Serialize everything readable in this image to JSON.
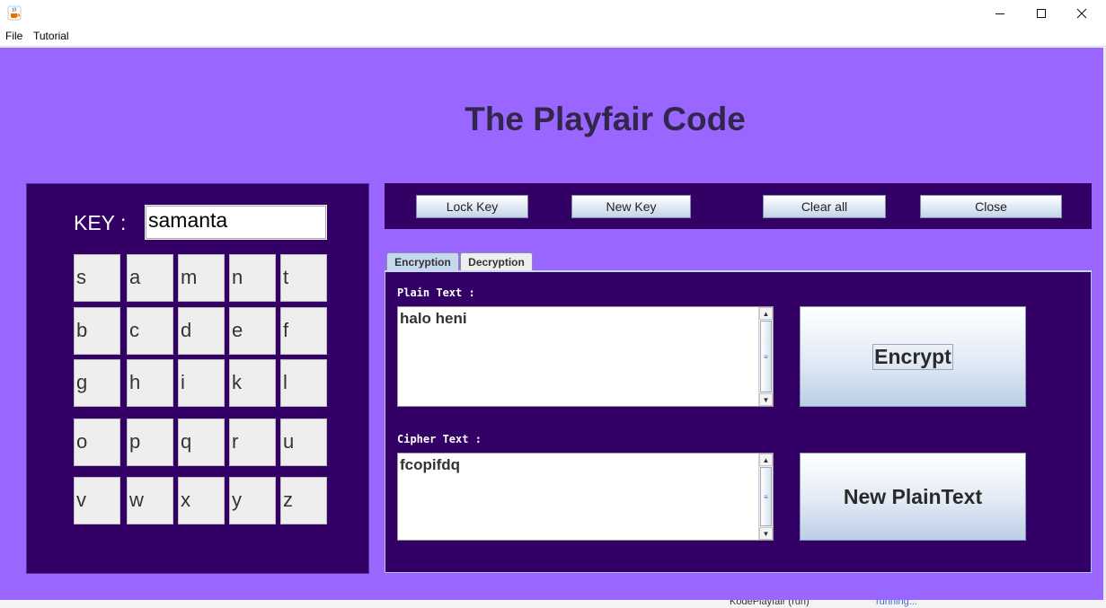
{
  "window": {
    "icons": {
      "app": "java-cup-icon",
      "minimize": "minimize-icon",
      "maximize": "maximize-icon",
      "close": "close-icon"
    }
  },
  "menubar": {
    "items": [
      {
        "label": "File"
      },
      {
        "label": "Tutorial"
      }
    ]
  },
  "page": {
    "title": "The Playfair Code"
  },
  "key_panel": {
    "key_label": "KEY :",
    "key_value": "samanta",
    "grid": [
      [
        "s",
        "a",
        "m",
        "n",
        "t"
      ],
      [
        "b",
        "c",
        "d",
        "e",
        "f"
      ],
      [
        "g",
        "h",
        "i",
        "k",
        "l"
      ],
      [
        "o",
        "p",
        "q",
        "r",
        "u"
      ],
      [
        "v",
        "w",
        "x",
        "y",
        "z"
      ]
    ]
  },
  "toolbar": {
    "lock_key": "Lock Key",
    "new_key": "New Key",
    "clear_all": "Clear all",
    "close": "Close"
  },
  "tabs": [
    {
      "label": "Encryption",
      "selected": true
    },
    {
      "label": "Decryption",
      "selected": false
    }
  ],
  "encryption": {
    "plain_label": "Plain Text :",
    "plain_value": "halo heni",
    "cipher_label": "Cipher Text :",
    "cipher_value": "fcopifdq",
    "encrypt_button": "Encrypt",
    "new_plaintext_button": "New PlainText"
  },
  "taskbar_fragment": {
    "left_text": "KodePlayfair (run)",
    "status_text": "running..."
  },
  "colors": {
    "background": "#9966ff",
    "panel": "#330066",
    "title": "#33264d"
  }
}
